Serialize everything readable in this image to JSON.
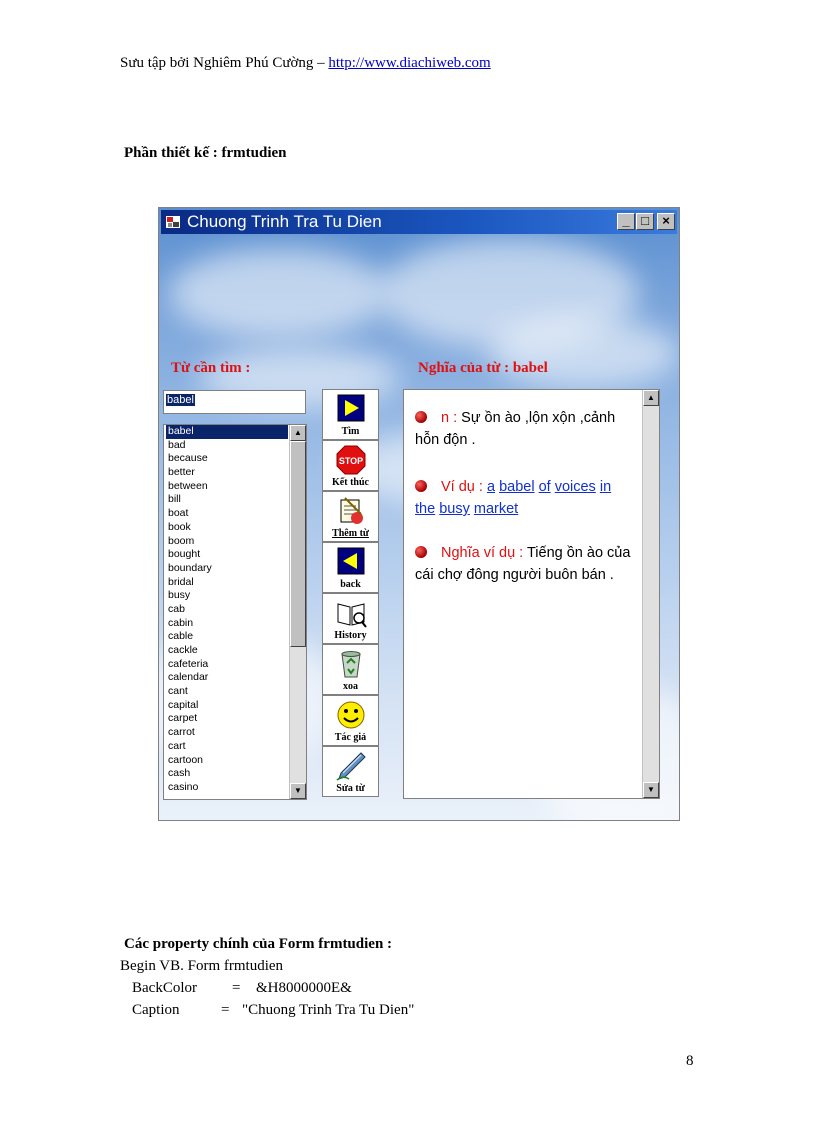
{
  "header": {
    "prefix": "Sưu tập bởi Nghiêm Phú Cường – ",
    "link": "http://www.diachiweb.com"
  },
  "section_title": "Phần thiết kế : frmtudien",
  "window": {
    "title": "Chuong Trinh Tra Tu Dien",
    "controls": {
      "minimize": "_",
      "maximize": "□",
      "close": "×"
    },
    "label_search": "Từ cần tìm :",
    "label_meaning": "Nghĩa của từ : babel",
    "search_value": "babel",
    "words": [
      "babel",
      "bad",
      "because",
      "better",
      "between",
      "bill",
      "boat",
      "book",
      "boom",
      "bought",
      "boundary",
      "bridal",
      "busy",
      "cab",
      "cabin",
      "cable",
      "cackle",
      "cafeteria",
      "calendar",
      "cant",
      "capital",
      "carpet",
      "carrot",
      "cart",
      "cartoon",
      "cash",
      "casino"
    ],
    "selected_word": "babel",
    "tools": [
      {
        "icon": "play-icon",
        "label": "Tìm"
      },
      {
        "icon": "stop-icon",
        "label": "Kết thúc"
      },
      {
        "icon": "add-word-icon",
        "label": "Thêm từ"
      },
      {
        "icon": "back-icon",
        "label": "back"
      },
      {
        "icon": "history-icon",
        "label": "History"
      },
      {
        "icon": "recycle-bin-icon",
        "label": "xoa"
      },
      {
        "icon": "smiley-icon",
        "label": "Tác giả"
      },
      {
        "icon": "pen-icon",
        "label": "Sửa từ"
      }
    ],
    "meaning": {
      "pos_label": "n :",
      "pos_text": " Sự ồn ào ,lộn xộn ,cảnh hỗn độn .",
      "example_label": "Ví dụ :",
      "example_words": [
        "a",
        "babel",
        "of",
        "voices",
        "in",
        "the",
        "busy",
        "market"
      ],
      "example_meaning_label": "Nghĩa ví dụ :",
      "example_meaning_text": " Tiếng ồn ào của cái chợ đông người buôn bán ."
    },
    "colors": {
      "title_bar": "#0a2a84",
      "label_red": "#e01010",
      "link_blue": "#1030d0",
      "selection": "#0a246a"
    }
  },
  "props_title": "Các property chính của Form frmtudien :",
  "code": {
    "line1": "Begin VB. Form frmtudien",
    "backcolor_key": "BackColor",
    "backcolor_eq": "=",
    "backcolor_val": "&H8000000E&",
    "caption_key": "Caption",
    "caption_eq": "=",
    "caption_val": "\"Chuong Trinh Tra Tu Dien\""
  },
  "page_number": "8"
}
